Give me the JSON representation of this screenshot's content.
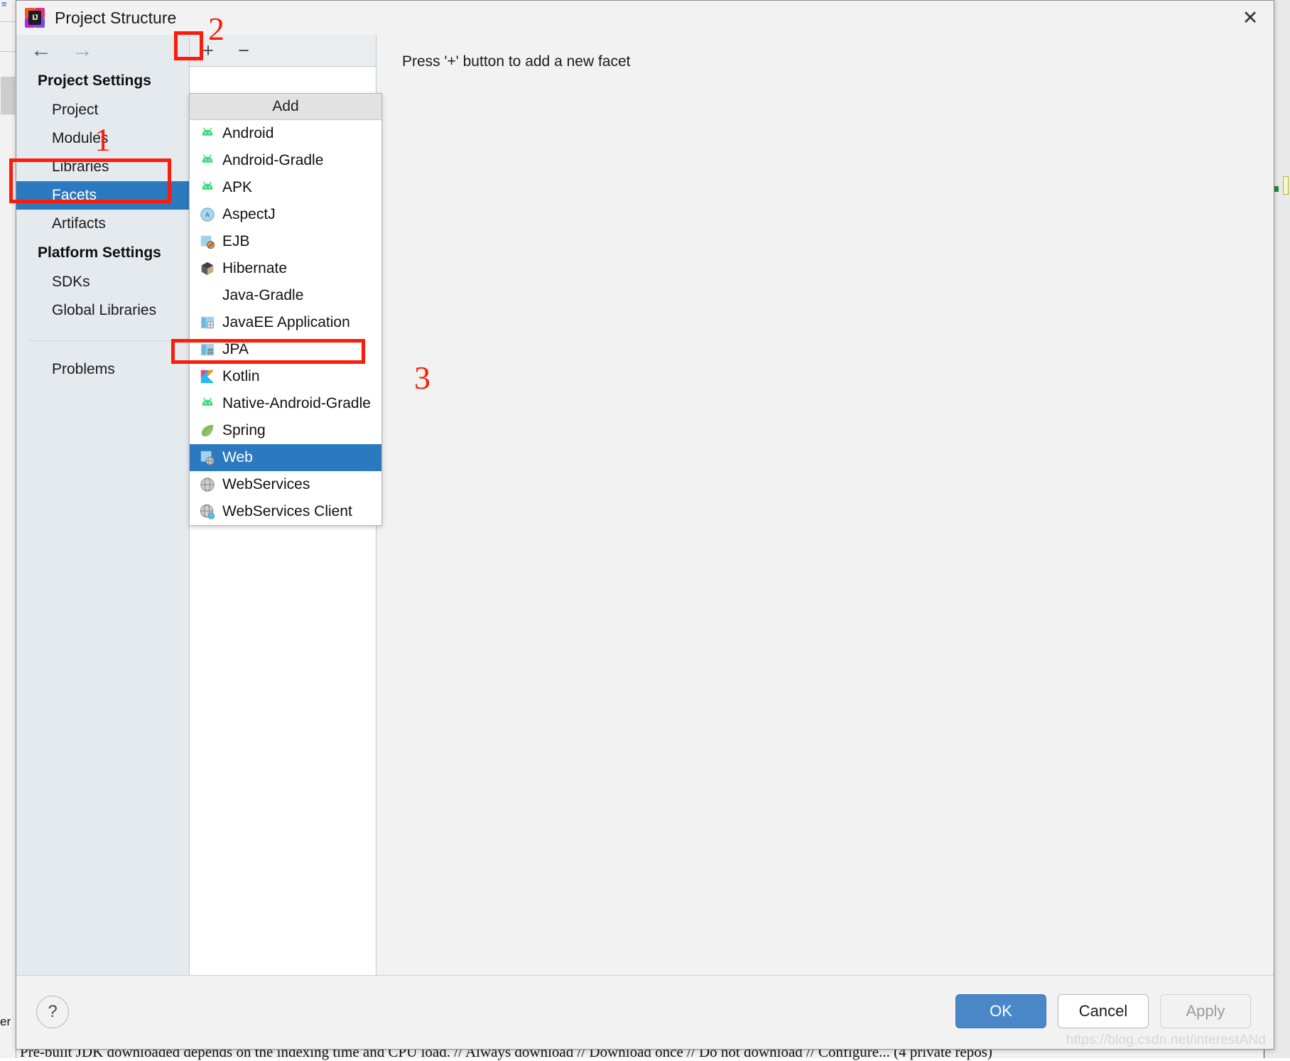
{
  "window": {
    "title": "Project Structure",
    "app_icon": "intellij-idea-logo",
    "close_icon": "✕",
    "back_icon": "←",
    "forward_icon": "→"
  },
  "sidebar": {
    "groups": [
      {
        "label": "Project Settings",
        "items": [
          {
            "label": "Project",
            "selected": false
          },
          {
            "label": "Modules",
            "selected": false
          },
          {
            "label": "Libraries",
            "selected": false
          },
          {
            "label": "Facets",
            "selected": true
          },
          {
            "label": "Artifacts",
            "selected": false
          }
        ]
      },
      {
        "label": "Platform Settings",
        "items": [
          {
            "label": "SDKs",
            "selected": false
          },
          {
            "label": "Global Libraries",
            "selected": false
          }
        ]
      }
    ],
    "extra_items": [
      {
        "label": "Problems",
        "selected": false
      }
    ]
  },
  "facets_toolbar": {
    "add_label": "+",
    "remove_label": "−"
  },
  "detail": {
    "hint": "Press '+' button to add a new facet"
  },
  "add_popup": {
    "header": "Add",
    "items": [
      {
        "label": "Android",
        "icon": "android-icon",
        "selected": false
      },
      {
        "label": "Android-Gradle",
        "icon": "android-icon",
        "selected": false
      },
      {
        "label": "APK",
        "icon": "android-icon",
        "selected": false
      },
      {
        "label": "AspectJ",
        "icon": "aspectj-icon",
        "selected": false
      },
      {
        "label": "EJB",
        "icon": "ejb-icon",
        "selected": false
      },
      {
        "label": "Hibernate",
        "icon": "hibernate-icon",
        "selected": false
      },
      {
        "label": "Java-Gradle",
        "icon": "none",
        "selected": false
      },
      {
        "label": "JavaEE Application",
        "icon": "javaee-application-icon",
        "selected": false
      },
      {
        "label": "JPA",
        "icon": "jpa-icon",
        "selected": false
      },
      {
        "label": "Kotlin",
        "icon": "kotlin-icon",
        "selected": false
      },
      {
        "label": "Native-Android-Gradle",
        "icon": "android-icon",
        "selected": false
      },
      {
        "label": "Spring",
        "icon": "spring-icon",
        "selected": false
      },
      {
        "label": "Web",
        "icon": "web-icon",
        "selected": true
      },
      {
        "label": "WebServices",
        "icon": "webservices-icon",
        "selected": false
      },
      {
        "label": "WebServices Client",
        "icon": "webservices-client-icon",
        "selected": false
      }
    ]
  },
  "footer": {
    "help_label": "?",
    "ok_label": "OK",
    "cancel_label": "Cancel",
    "apply_label": "Apply",
    "apply_disabled": true
  },
  "annotations": [
    {
      "label": "1"
    },
    {
      "label": "2"
    },
    {
      "label": "3"
    }
  ],
  "watermark": "https://blog.csdn.net/interestANd",
  "background": {
    "bottom_text": "Pre-built JDK downloaded depends on the indexing time and CPU load. // Always download // Download once // Do not download // Configure... (4 private repos)",
    "edge_text": "er"
  },
  "colors": {
    "accent": "#2b7ac0",
    "annotation": "#fb1c0a",
    "primary_button": "#4a87c8",
    "sidebar_bg": "#e5eaee"
  }
}
